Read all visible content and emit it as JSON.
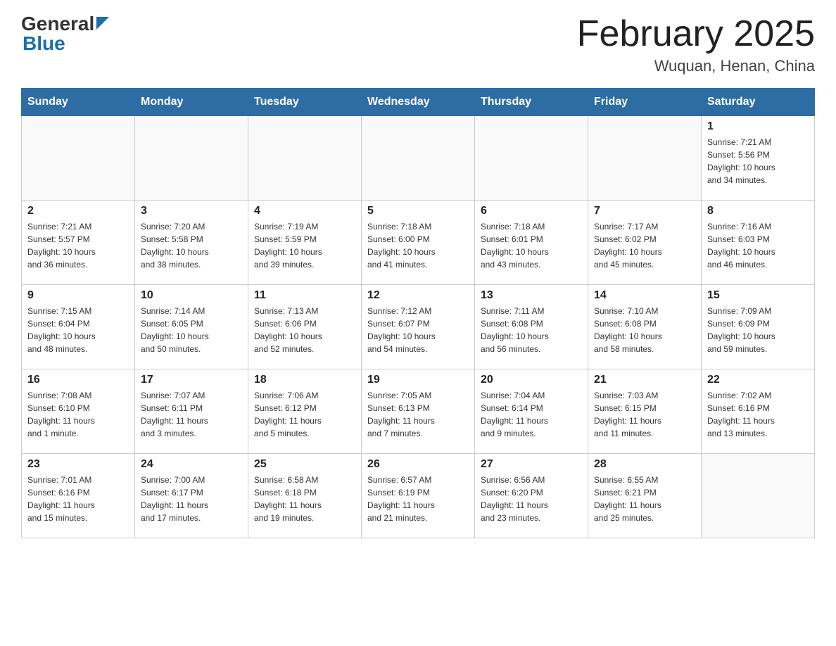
{
  "header": {
    "logo_general": "General",
    "logo_blue": "Blue",
    "title": "February 2025",
    "subtitle": "Wuquan, Henan, China"
  },
  "days_of_week": [
    "Sunday",
    "Monday",
    "Tuesday",
    "Wednesday",
    "Thursday",
    "Friday",
    "Saturday"
  ],
  "weeks": [
    [
      {
        "day": "",
        "info": ""
      },
      {
        "day": "",
        "info": ""
      },
      {
        "day": "",
        "info": ""
      },
      {
        "day": "",
        "info": ""
      },
      {
        "day": "",
        "info": ""
      },
      {
        "day": "",
        "info": ""
      },
      {
        "day": "1",
        "info": "Sunrise: 7:21 AM\nSunset: 5:56 PM\nDaylight: 10 hours\nand 34 minutes."
      }
    ],
    [
      {
        "day": "2",
        "info": "Sunrise: 7:21 AM\nSunset: 5:57 PM\nDaylight: 10 hours\nand 36 minutes."
      },
      {
        "day": "3",
        "info": "Sunrise: 7:20 AM\nSunset: 5:58 PM\nDaylight: 10 hours\nand 38 minutes."
      },
      {
        "day": "4",
        "info": "Sunrise: 7:19 AM\nSunset: 5:59 PM\nDaylight: 10 hours\nand 39 minutes."
      },
      {
        "day": "5",
        "info": "Sunrise: 7:18 AM\nSunset: 6:00 PM\nDaylight: 10 hours\nand 41 minutes."
      },
      {
        "day": "6",
        "info": "Sunrise: 7:18 AM\nSunset: 6:01 PM\nDaylight: 10 hours\nand 43 minutes."
      },
      {
        "day": "7",
        "info": "Sunrise: 7:17 AM\nSunset: 6:02 PM\nDaylight: 10 hours\nand 45 minutes."
      },
      {
        "day": "8",
        "info": "Sunrise: 7:16 AM\nSunset: 6:03 PM\nDaylight: 10 hours\nand 46 minutes."
      }
    ],
    [
      {
        "day": "9",
        "info": "Sunrise: 7:15 AM\nSunset: 6:04 PM\nDaylight: 10 hours\nand 48 minutes."
      },
      {
        "day": "10",
        "info": "Sunrise: 7:14 AM\nSunset: 6:05 PM\nDaylight: 10 hours\nand 50 minutes."
      },
      {
        "day": "11",
        "info": "Sunrise: 7:13 AM\nSunset: 6:06 PM\nDaylight: 10 hours\nand 52 minutes."
      },
      {
        "day": "12",
        "info": "Sunrise: 7:12 AM\nSunset: 6:07 PM\nDaylight: 10 hours\nand 54 minutes."
      },
      {
        "day": "13",
        "info": "Sunrise: 7:11 AM\nSunset: 6:08 PM\nDaylight: 10 hours\nand 56 minutes."
      },
      {
        "day": "14",
        "info": "Sunrise: 7:10 AM\nSunset: 6:08 PM\nDaylight: 10 hours\nand 58 minutes."
      },
      {
        "day": "15",
        "info": "Sunrise: 7:09 AM\nSunset: 6:09 PM\nDaylight: 10 hours\nand 59 minutes."
      }
    ],
    [
      {
        "day": "16",
        "info": "Sunrise: 7:08 AM\nSunset: 6:10 PM\nDaylight: 11 hours\nand 1 minute."
      },
      {
        "day": "17",
        "info": "Sunrise: 7:07 AM\nSunset: 6:11 PM\nDaylight: 11 hours\nand 3 minutes."
      },
      {
        "day": "18",
        "info": "Sunrise: 7:06 AM\nSunset: 6:12 PM\nDaylight: 11 hours\nand 5 minutes."
      },
      {
        "day": "19",
        "info": "Sunrise: 7:05 AM\nSunset: 6:13 PM\nDaylight: 11 hours\nand 7 minutes."
      },
      {
        "day": "20",
        "info": "Sunrise: 7:04 AM\nSunset: 6:14 PM\nDaylight: 11 hours\nand 9 minutes."
      },
      {
        "day": "21",
        "info": "Sunrise: 7:03 AM\nSunset: 6:15 PM\nDaylight: 11 hours\nand 11 minutes."
      },
      {
        "day": "22",
        "info": "Sunrise: 7:02 AM\nSunset: 6:16 PM\nDaylight: 11 hours\nand 13 minutes."
      }
    ],
    [
      {
        "day": "23",
        "info": "Sunrise: 7:01 AM\nSunset: 6:16 PM\nDaylight: 11 hours\nand 15 minutes."
      },
      {
        "day": "24",
        "info": "Sunrise: 7:00 AM\nSunset: 6:17 PM\nDaylight: 11 hours\nand 17 minutes."
      },
      {
        "day": "25",
        "info": "Sunrise: 6:58 AM\nSunset: 6:18 PM\nDaylight: 11 hours\nand 19 minutes."
      },
      {
        "day": "26",
        "info": "Sunrise: 6:57 AM\nSunset: 6:19 PM\nDaylight: 11 hours\nand 21 minutes."
      },
      {
        "day": "27",
        "info": "Sunrise: 6:56 AM\nSunset: 6:20 PM\nDaylight: 11 hours\nand 23 minutes."
      },
      {
        "day": "28",
        "info": "Sunrise: 6:55 AM\nSunset: 6:21 PM\nDaylight: 11 hours\nand 25 minutes."
      },
      {
        "day": "",
        "info": ""
      }
    ]
  ]
}
